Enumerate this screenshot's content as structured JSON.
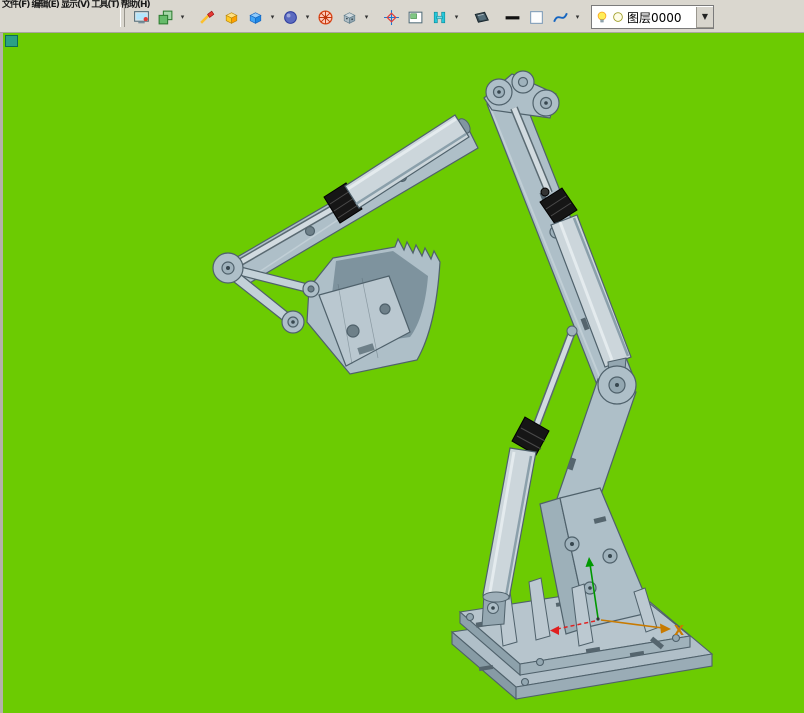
{
  "app": {
    "menu_text": "文件(F) 编辑(E) 显示(V) 工具(T) 帮助(H)",
    "colors": {
      "toolbar_background": "#dad7cf",
      "viewport_background": "#6ccb02",
      "model_body": "#aebfc8",
      "model_body_light": "#c3d1d8",
      "model_body_dark": "#8ba0ab",
      "model_outline": "#4f616b",
      "cylinder_silver": "#ccd6db",
      "thread_black": "#161616",
      "axis_x_color": "#c87a00",
      "axis_y_color": "#009900",
      "axis_hidden_color": "#e02020"
    }
  },
  "toolbar": {
    "icons": [
      {
        "name": "capture-view-icon",
        "has_dropdown": false
      },
      {
        "name": "display-mode-icon",
        "has_dropdown": true
      },
      {
        "name": "repaint-icon",
        "has_dropdown": false
      },
      {
        "name": "isometric-view-icon",
        "has_dropdown": false
      },
      {
        "name": "standard-view-icon",
        "has_dropdown": true
      },
      {
        "name": "shading-icon",
        "has_dropdown": true
      },
      {
        "name": "render-wheel-icon",
        "has_dropdown": false
      },
      {
        "name": "material-icon",
        "has_dropdown": true
      },
      {
        "name": "locate-center-icon",
        "has_dropdown": false
      },
      {
        "name": "zoom-window-icon",
        "has_dropdown": false
      },
      {
        "name": "grid-icon",
        "has_dropdown": true
      },
      {
        "name": "display-3d-icon",
        "has_dropdown": false
      },
      {
        "name": "line-width-icon",
        "has_dropdown": false
      },
      {
        "name": "color-swatch-icon",
        "has_dropdown": false
      },
      {
        "name": "spline-icon",
        "has_dropdown": true
      }
    ],
    "layer_selector": {
      "value": "图层0000",
      "icons": [
        "light-bulb-icon",
        "layer-color-icon"
      ],
      "dropdown_glyph": "▼"
    }
  },
  "viewport": {
    "model_name": "excavator-arm-assembly",
    "axes": {
      "x_label": "X"
    }
  }
}
